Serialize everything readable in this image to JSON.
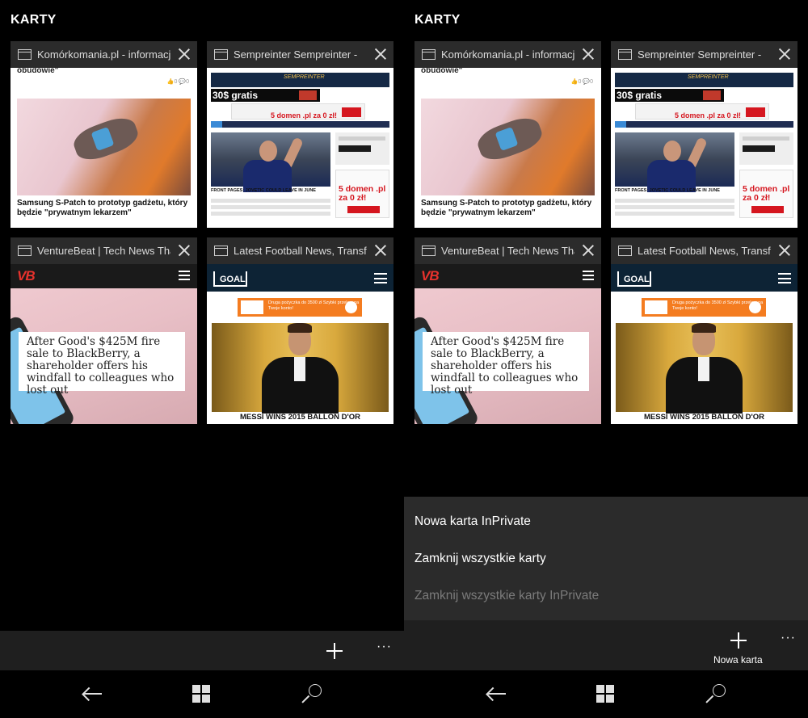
{
  "screen_left": {
    "title": "KARTY",
    "tabs": [
      {
        "title": "Komórkomania.pl - informacje",
        "snippet": "obudowie\"",
        "stats": "👍0 💬0",
        "headline": "Samsung S-Patch to prototyp gadżetu, który będzie \"prywatnym lekarzem\""
      },
      {
        "title": "Sempreinter Sempreinter -",
        "promo": "5 domen .pl za 0 zł!",
        "ad_big": "30$ gratis",
        "front": "FRONT PAGES: JOVETIC COULD LEAVE IN JUNE",
        "side_promo": "5 domen .pl za 0 zł!"
      },
      {
        "title": "VentureBeat | Tech News That",
        "logo": "VB",
        "headline": "After Good's $425M fire sale to BlackBerry, a shareholder offers his windfall to colleagues who lost out"
      },
      {
        "title": "Latest Football News, Transfer",
        "logo": "GOAL",
        "ad_text": "Druga pożyczka do 3500 zł Szybki przelew na Twoje konto!",
        "caption": "MESSI WINS 2015 BALLON D'OR"
      }
    ],
    "appbar": {
      "new_tab_icon": "plus-icon",
      "more": "···"
    }
  },
  "screen_right": {
    "title": "KARTY",
    "tabs": [
      {
        "title": "Komórkomania.pl - informacje",
        "snippet": "obudowie\"",
        "stats": "👍0 💬0",
        "headline": "Samsung S-Patch to prototyp gadżetu, który będzie \"prywatnym lekarzem\""
      },
      {
        "title": "Sempreinter Sempreinter -",
        "promo": "5 domen .pl za 0 zł!",
        "ad_big": "30$ gratis",
        "front": "FRONT PAGES: JOVETIC COULD LEAVE IN JUNE",
        "side_promo": "5 domen .pl za 0 zł!"
      },
      {
        "title": "VentureBeat | Tech News That",
        "logo": "VB",
        "headline": "After Good's $425M fire sale to BlackBerry, a shareholder offers his windfall to colleagues who lost out"
      },
      {
        "title": "Latest Football News, Transfer",
        "logo": "GOAL",
        "ad_text": "Druga pożyczka do 3500 zł Szybki przelew na Twoje konto!",
        "caption": "MESSI WINS 2015 BALLON D'OR"
      }
    ],
    "menu": {
      "items": [
        {
          "label": "Nowa karta InPrivate",
          "enabled": true
        },
        {
          "label": "Zamknij wszystkie karty",
          "enabled": true
        },
        {
          "label": "Zamknij wszystkie karty InPrivate",
          "enabled": false
        }
      ]
    },
    "appbar": {
      "new_tab_label": "Nowa karta",
      "more": "···"
    }
  },
  "navbar": {
    "back": "back-arrow-icon",
    "start": "windows-start-icon",
    "search": "search-icon"
  },
  "colors": {
    "background": "#000000",
    "appbar": "#1f1f1f",
    "menu": "#2b2b2b",
    "disabled_text": "#7b7b7b"
  }
}
